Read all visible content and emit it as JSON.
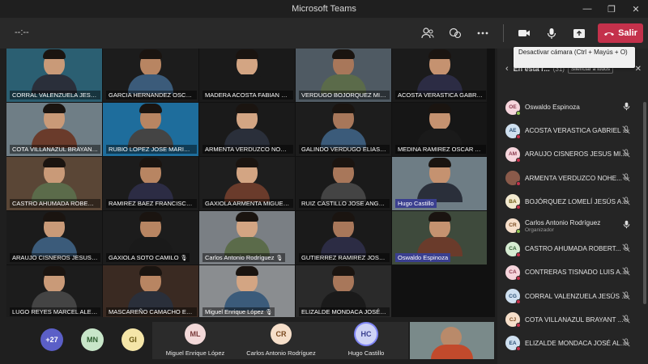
{
  "window": {
    "title": "Microsoft Teams",
    "minimize": "—",
    "maximize": "❐",
    "close": "✕"
  },
  "toolbar": {
    "timer": "--:--",
    "leave_label": "Salir",
    "tooltip": "Desactivar cámara (Ctrl + Mayús + O)"
  },
  "grid": {
    "tiles": [
      {
        "name": "CORRAL VALENZUELA JESUS ...",
        "bg": "#2b5f72"
      },
      {
        "name": "GARCIA HERNANDEZ OSCAR...",
        "bg": "#1c1c1c"
      },
      {
        "name": "MADERA ACOSTA FABIAN N...",
        "bg": "#1a1a1a"
      },
      {
        "name": "VERDUGO BOJORQUEZ MIG...",
        "bg": "#4f5a63"
      },
      {
        "name": "ACOSTA VERASTICA GABRIE...",
        "bg": "#1b1b1b"
      },
      {
        "name": "COTA VILLANAZUL BRAYAN...",
        "bg": "#6f7e86"
      },
      {
        "name": "RUBIO LOPEZ JOSE MARIO",
        "bg": "#1e6d9c"
      },
      {
        "name": "ARMENTA VERDUZCO NOHE...",
        "bg": "#1a1a1a"
      },
      {
        "name": "GALINDO VERDUGO ELIAS R...",
        "bg": "#1d1d1d"
      },
      {
        "name": "MEDINA RAMIREZ OSCAR AL...",
        "bg": "#161616"
      },
      {
        "name": "CASTRO AHUMADA ROBERT...",
        "bg": "#5a4636"
      },
      {
        "name": "RAMIREZ BAEZ FRANCISCO",
        "bg": "#1c1c1c"
      },
      {
        "name": "GAXIOLA ARMENTA MIGUEL",
        "bg": "#1e1e1e"
      },
      {
        "name": "RUIZ CASTILLO JOSE ANGEL",
        "bg": "#1a1a1a"
      },
      {
        "name": "Hugo Castillo",
        "bg": "#6e7d85",
        "highlight": true
      },
      {
        "name": "ARAUJO CISNEROS JESUS MI...",
        "bg": "#1b1b1b"
      },
      {
        "name": "GAXIOLA SOTO CAMILO",
        "bg": "#1c1c1c"
      },
      {
        "name": "Carlos Antonio Rodríguez",
        "bg": "#7a7f84"
      },
      {
        "name": "GUTIERREZ RAMIREZ JOSE C...",
        "bg": "#1a1a1a"
      },
      {
        "name": "Oswaldo Espinoza",
        "bg": "#3e4a3c",
        "highlight": true
      },
      {
        "name": "LUGO REYES MARCEL ALEJA...",
        "bg": "#1c1c1c"
      },
      {
        "name": "MASCAREÑO CAMACHO ERI...",
        "bg": "#3a2a22"
      },
      {
        "name": "Miguel Enrique López",
        "bg": "#8a8d90"
      },
      {
        "name": "ELIZALDE MONDACA JOSÉ A...",
        "bg": "#2a2a2a"
      }
    ]
  },
  "bottom_strip": {
    "overflow": "+27",
    "avatars": [
      {
        "initials": "MN",
        "bg": "#c8e6c9",
        "fg": "#2e5e30"
      },
      {
        "initials": "GI",
        "bg": "#f5e6a8",
        "fg": "#6b5a12"
      }
    ],
    "tiles": [
      {
        "initials": "ML",
        "name": "Miguel Enrique López",
        "bg": "#f3d9d9",
        "fg": "#7a3a3a"
      },
      {
        "initials": "CR",
        "name": "Carlos Antonio Rodríguez",
        "bg": "#f6dfca",
        "fg": "#7a4a20"
      },
      {
        "initials": "HC",
        "name": "Hugo Castillo",
        "bg": "#cfd3f5",
        "fg": "#3a3f8f"
      }
    ]
  },
  "panel": {
    "title": "En esta r...",
    "count": "(31)",
    "mute_all": "Silenciar a todos",
    "close": "✕",
    "participants": [
      {
        "initials": "OE",
        "name": "Oswaldo Espinoza",
        "role": "",
        "bg": "#f6d5dc",
        "fg": "#8a3b4e",
        "mic": "on"
      },
      {
        "initials": "AE",
        "name": "ACOSTA VERASTICA GABRIEL ...",
        "role": "",
        "bg": "#cfe0f0",
        "fg": "#2b4f73",
        "mic": "off"
      },
      {
        "initials": "AM",
        "name": "ARAUJO CISNEROS JESUS MI...",
        "role": "",
        "bg": "#f6d5dc",
        "fg": "#8a3b4e",
        "mic": "off"
      },
      {
        "initials": "",
        "name": "ARMENTA VERDUZCO NOHE...",
        "role": "",
        "bg": "#8a5a4a",
        "fg": "#fff",
        "mic": "off"
      },
      {
        "initials": "BA",
        "name": "BOJÓRQUEZ LOMELÍ JESÚS A...",
        "role": "",
        "bg": "#f3ead0",
        "fg": "#6b5a12",
        "mic": "off"
      },
      {
        "initials": "CR",
        "name": "Carlos Antonio Rodríguez",
        "role": "Organizador",
        "bg": "#f6dfca",
        "fg": "#7a4a20",
        "mic": "on"
      },
      {
        "initials": "CA",
        "name": "CASTRO AHUMADA ROBERT...",
        "role": "",
        "bg": "#d6ecd2",
        "fg": "#2e5e30",
        "mic": "off"
      },
      {
        "initials": "CA",
        "name": "CONTRERAS TISNADO LUIS A...",
        "role": "",
        "bg": "#f6d5dc",
        "fg": "#8a3b4e",
        "mic": "off"
      },
      {
        "initials": "CG",
        "name": "CORRAL VALENZUELA JESÚS ...",
        "role": "",
        "bg": "#cfe0f0",
        "fg": "#2b4f73",
        "mic": "off"
      },
      {
        "initials": "CJ",
        "name": "COTA VILLANAZUL BRAYANT ...",
        "role": "",
        "bg": "#f6dfca",
        "fg": "#7a4a20",
        "mic": "off"
      },
      {
        "initials": "EA",
        "name": "ELIZALDE MONDACA JOSÉ AL...",
        "role": "",
        "bg": "#cfe0f0",
        "fg": "#2b4f73",
        "mic": "off"
      }
    ]
  }
}
